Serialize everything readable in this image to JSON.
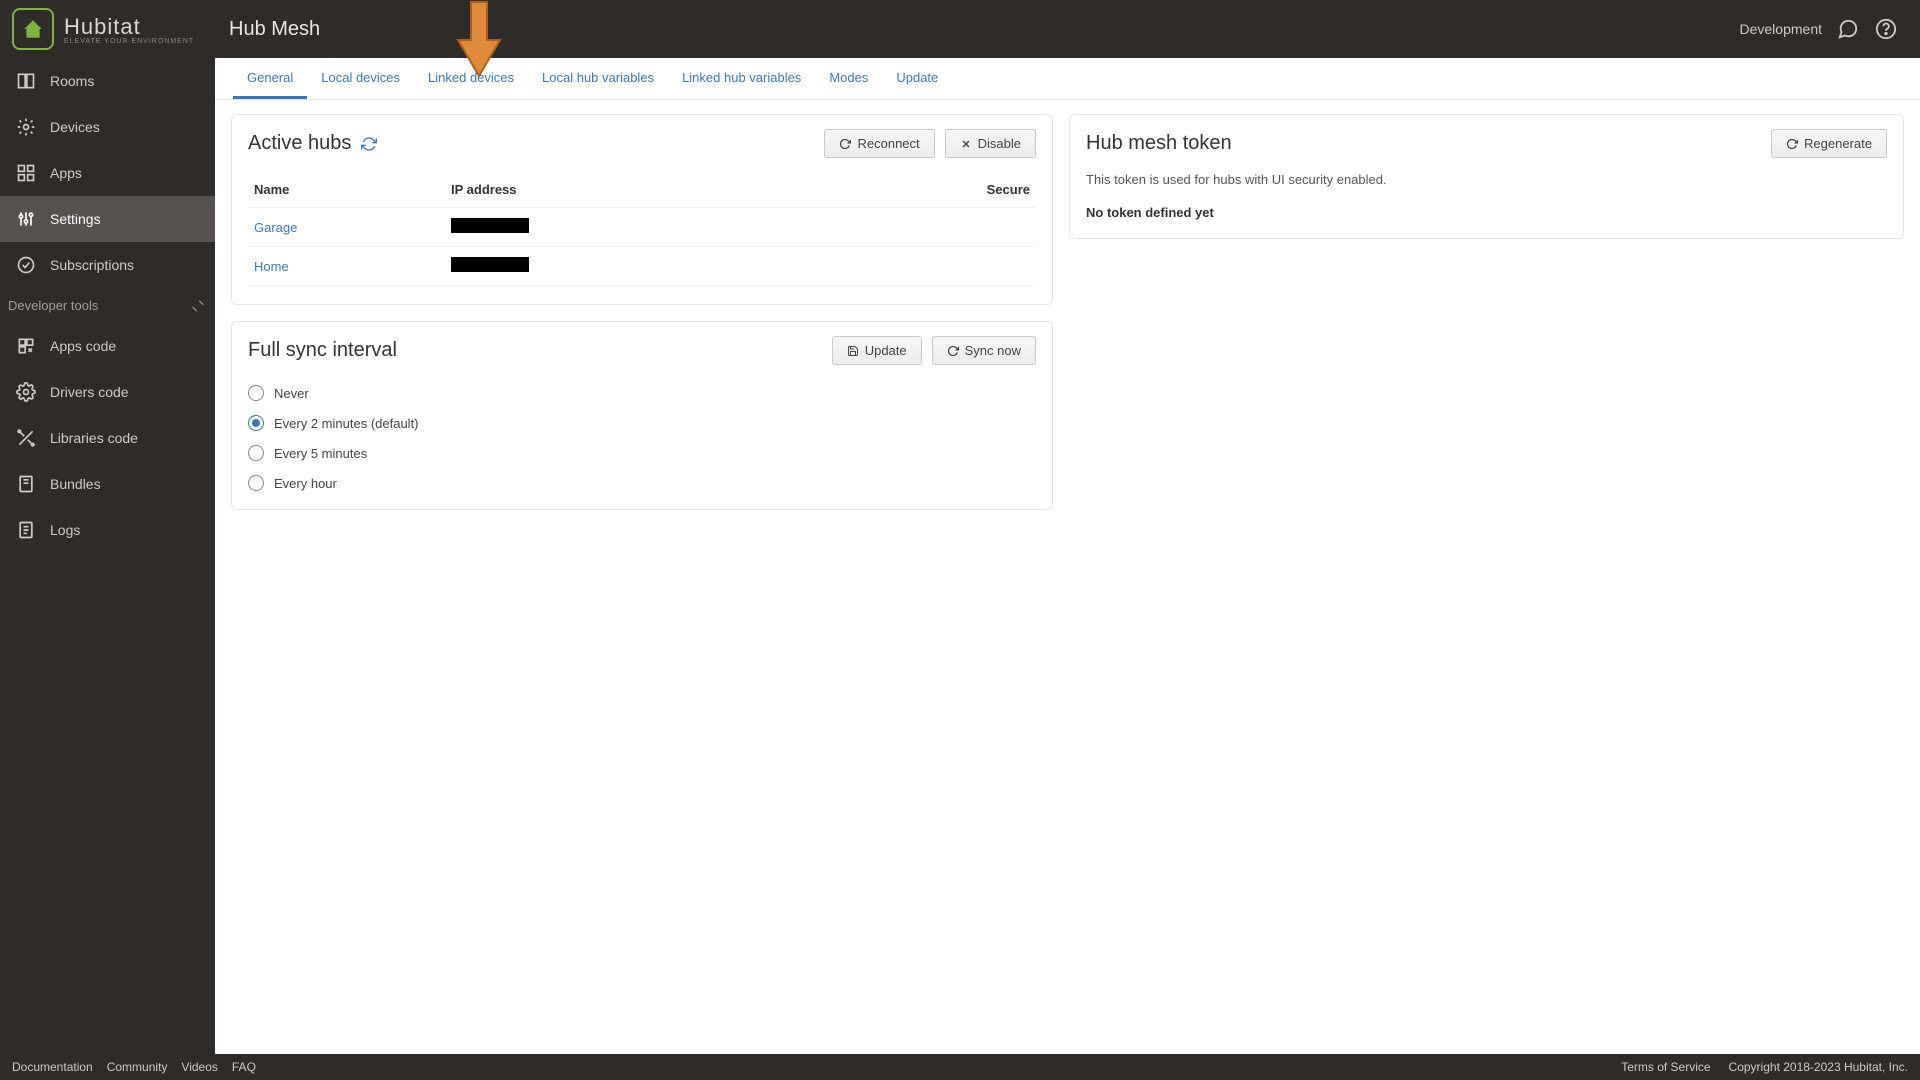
{
  "brand": {
    "name": "Hubitat",
    "tagline": "ELEVATE YOUR ENVIRONMENT"
  },
  "page_title": "Hub Mesh",
  "header": {
    "env_label": "Development"
  },
  "sidebar": {
    "items": [
      {
        "label": "Rooms"
      },
      {
        "label": "Devices"
      },
      {
        "label": "Apps"
      },
      {
        "label": "Settings"
      },
      {
        "label": "Subscriptions"
      }
    ],
    "section_label": "Developer tools",
    "dev_items": [
      {
        "label": "Apps code"
      },
      {
        "label": "Drivers code"
      },
      {
        "label": "Libraries code"
      },
      {
        "label": "Bundles"
      },
      {
        "label": "Logs"
      }
    ]
  },
  "tabs": [
    {
      "label": "General"
    },
    {
      "label": "Local devices"
    },
    {
      "label": "Linked devices"
    },
    {
      "label": "Local hub variables"
    },
    {
      "label": "Linked hub variables"
    },
    {
      "label": "Modes"
    },
    {
      "label": "Update"
    }
  ],
  "active_hubs": {
    "title": "Active hubs",
    "reconnect_label": "Reconnect",
    "disable_label": "Disable",
    "columns": {
      "name": "Name",
      "ip": "IP address",
      "secure": "Secure"
    },
    "rows": [
      {
        "name": "Garage"
      },
      {
        "name": "Home"
      }
    ]
  },
  "sync": {
    "title": "Full sync interval",
    "update_label": "Update",
    "syncnow_label": "Sync now",
    "options": [
      {
        "label": "Never"
      },
      {
        "label": "Every 2 minutes (default)"
      },
      {
        "label": "Every 5 minutes"
      },
      {
        "label": "Every hour"
      }
    ],
    "selected_index": 1
  },
  "token": {
    "title": "Hub mesh token",
    "regenerate_label": "Regenerate",
    "description": "This token is used for hubs with UI security enabled.",
    "empty_text": "No token defined yet"
  },
  "footer": {
    "links": [
      "Documentation",
      "Community",
      "Videos",
      "FAQ"
    ],
    "terms": "Terms of Service",
    "copyright": "Copyright 2018-2023 Hubitat, Inc."
  }
}
